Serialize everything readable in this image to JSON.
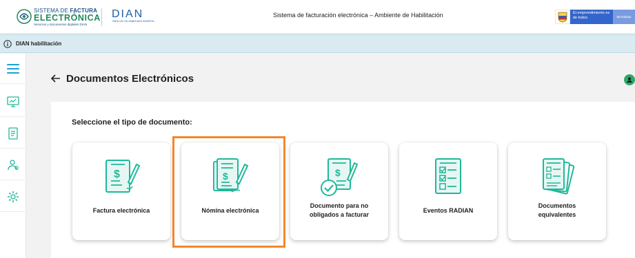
{
  "header": {
    "logo_sfe_line1_a": "SISTEMA DE ",
    "logo_sfe_line1_b": "FACTURA",
    "logo_sfe_line2": "ELECTRÓNICA",
    "logo_sfe_line3": "Servicios y documentos digitales DIAN",
    "logo_dian": "DIAN",
    "logo_dian_sub": "PARA UN COLOMBIA MÁS HONESTA",
    "title": "Sistema de facturación electrónica – Ambiente de Habilitación",
    "gov_badge_text": "El emprendimiento es de todos",
    "gov_badge_ministry": "Mintrabajo"
  },
  "env_bar": {
    "label": "DIAN habilitación",
    "icon": "info-icon"
  },
  "sidebar": {
    "items": [
      {
        "name": "menu-icon"
      },
      {
        "name": "monitor-chart-icon"
      },
      {
        "name": "document-list-icon"
      },
      {
        "name": "user-settings-icon"
      },
      {
        "name": "gear-icon"
      }
    ]
  },
  "page": {
    "title": "Documentos Electrónicos",
    "prompt": "Seleccione el tipo de documento:"
  },
  "cards": [
    {
      "label_line1": "Factura electrónica",
      "label_line2": "",
      "icon": "invoice-pen-icon"
    },
    {
      "label_line1": "Nómina electrónica",
      "label_line2": "",
      "icon": "payroll-pen-icon"
    },
    {
      "label_line1": "Documento para no",
      "label_line2": "obligados a facturar",
      "icon": "document-check-icon"
    },
    {
      "label_line1": "Eventos RADIAN",
      "label_line2": "",
      "icon": "checklist-icon"
    },
    {
      "label_line1": "Documentos",
      "label_line2": "equivalentes",
      "icon": "stacked-documents-icon"
    }
  ],
  "colors": {
    "accent_teal": "#1fb89a",
    "highlight_orange": "#f5852b",
    "env_bar_bg": "#d9ebf1",
    "gov_blue": "#3366cc"
  }
}
